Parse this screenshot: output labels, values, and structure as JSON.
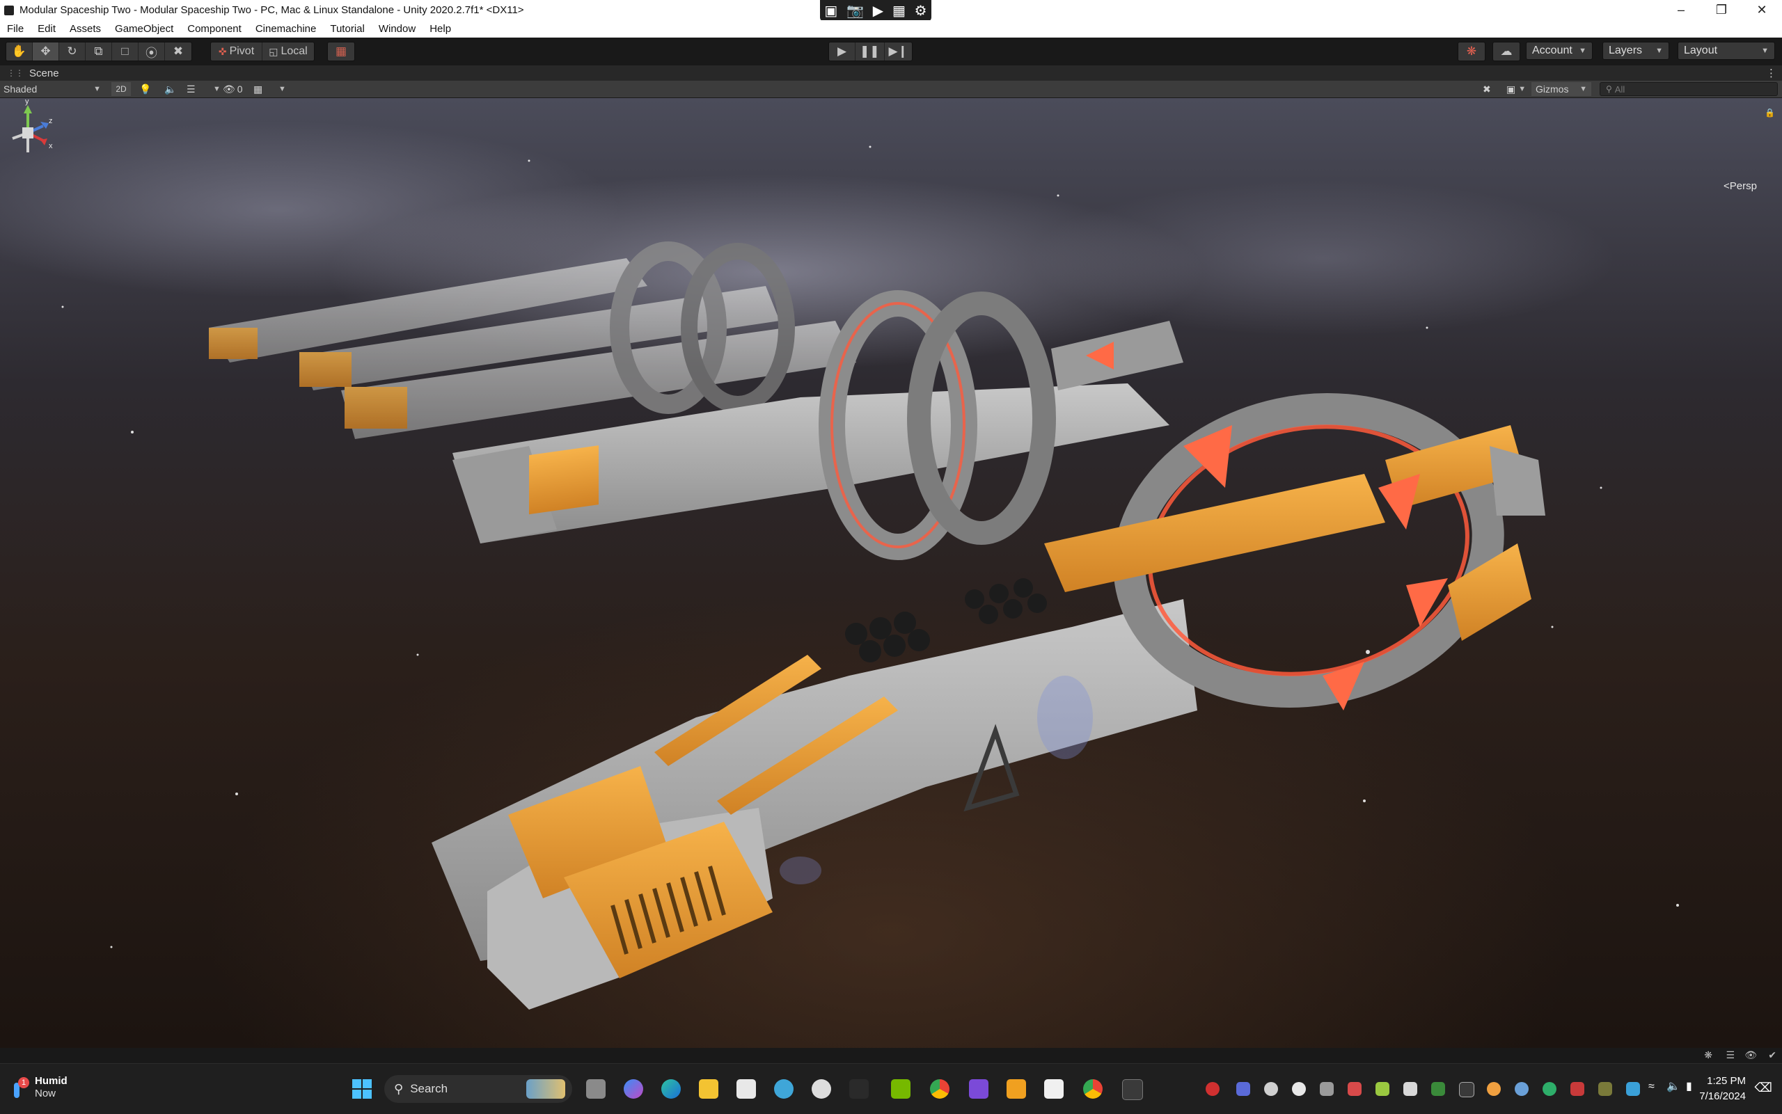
{
  "window": {
    "title": "Modular Spaceship Two - Modular Spaceship Two - PC, Mac & Linux Standalone - Unity 2020.2.7f1* <DX11>",
    "minimize": "–",
    "maximize": "❐",
    "close": "✕"
  },
  "menu": {
    "items": [
      "File",
      "Edit",
      "Assets",
      "GameObject",
      "Component",
      "Cinemachine",
      "Tutorial",
      "Window",
      "Help"
    ]
  },
  "toolbar": {
    "pivot_label": "Pivot",
    "local_label": "Local",
    "account_label": "Account",
    "layers_label": "Layers",
    "layout_label": "Layout"
  },
  "scene": {
    "tab_label": "Scene",
    "shading_mode": "Shaded",
    "mode_2d": "2D",
    "hidden_count": "0",
    "gizmos_label": "Gizmos",
    "search_placeholder": "All",
    "persp_label": "<Persp",
    "axis_y": "y",
    "axis_z": "z",
    "axis_x": "x"
  },
  "taskbar": {
    "weather_title": "Humid",
    "weather_sub": "Now",
    "weather_badge": "1",
    "search_label": "Search",
    "time": "1:25 PM",
    "date": "7/16/2024"
  },
  "colors": {
    "hull": "#a9a9a9",
    "accent_orange": "#f1a33a",
    "glow_red": "#ff5a3c"
  }
}
